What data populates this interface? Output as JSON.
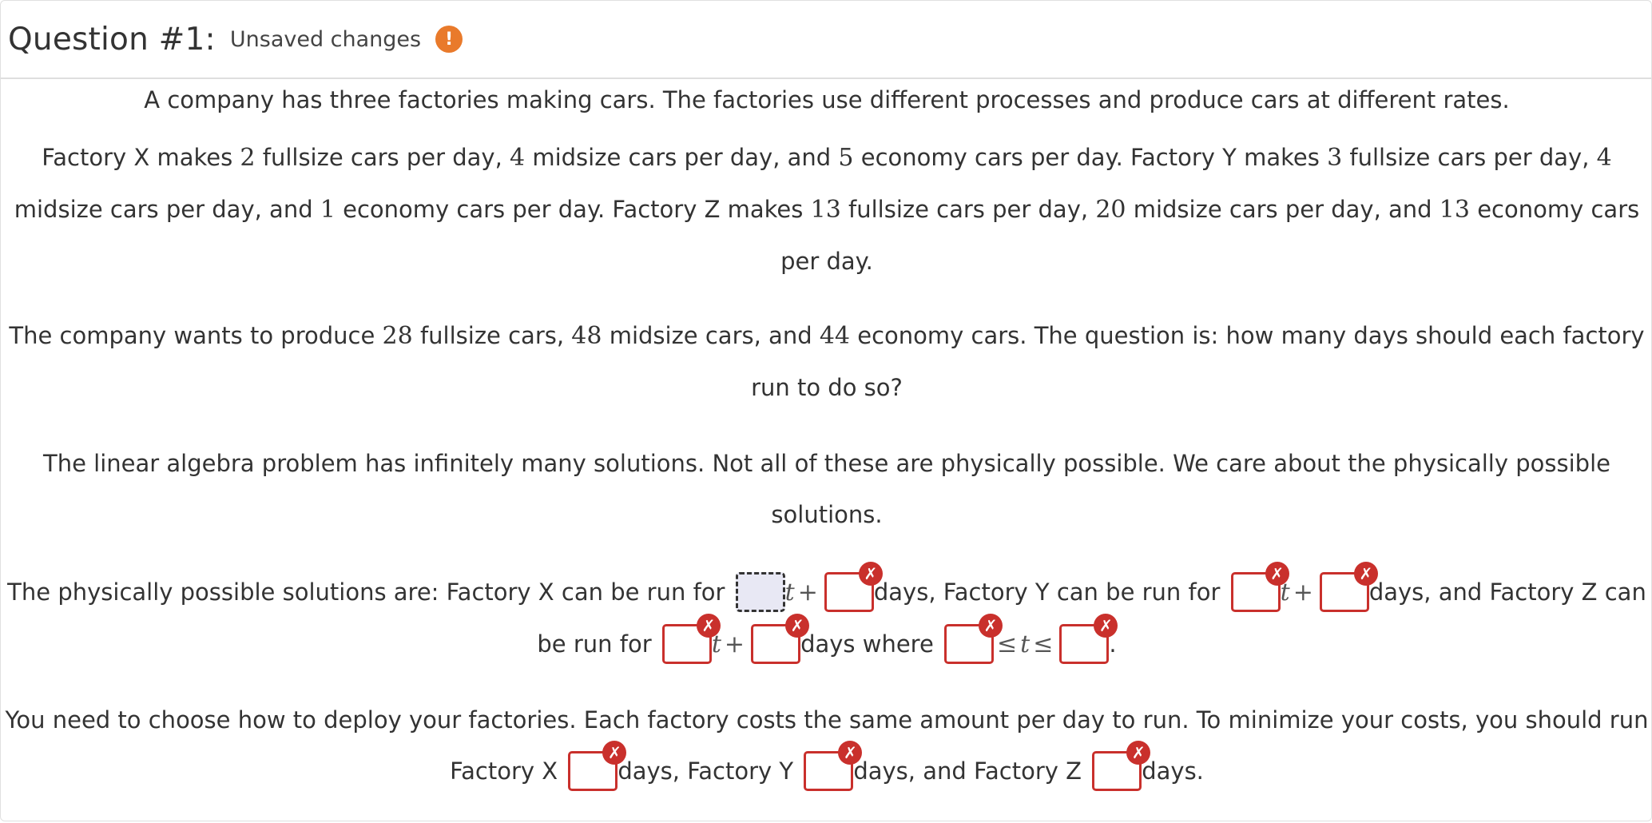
{
  "header": {
    "title": "Question #1:",
    "status": "Unsaved changes",
    "warning_glyph": "!"
  },
  "intro": "A company has three factories making cars. The factories use different processes and produce cars at different rates.",
  "rates": {
    "p1": "Factory X makes ",
    "x_full": "2",
    "p2": " fullsize cars per day, ",
    "x_mid": "4",
    "p3": " midsize cars per day, and ",
    "x_eco": "5",
    "p4": " economy cars per day. Factory Y makes ",
    "y_full": "3",
    "p5": " fullsize cars per day, ",
    "y_mid": "4",
    "p6": " midsize cars per day, and ",
    "y_eco": "1",
    "p7": " economy cars per day. Factory Z makes ",
    "z_full": "13",
    "p8": " fullsize cars per day, ",
    "z_mid": "20",
    "p9": " midsize cars per day, and ",
    "z_eco": "13",
    "p10": " economy cars per day."
  },
  "goal": {
    "p1": "The company wants to produce ",
    "full": "28",
    "p2": " fullsize cars, ",
    "mid": "48",
    "p3": " midsize cars, and ",
    "eco": "44",
    "p4": " economy cars. The question is: how many days should each factory run to do so?"
  },
  "note": "The linear algebra problem has infinitely many solutions. Not all of these are physically possible. We care about the physically possible solutions.",
  "solutions": {
    "p1": "The physically possible solutions are: Factory X can be run for ",
    "var": "t",
    "plus": "+",
    "p2": "days, Factory Y can be run for ",
    "p3": "days, and Factory Z can be run for ",
    "p4": "days where ",
    "leq": "≤",
    "end": "."
  },
  "deploy": {
    "p1": "You need to choose how to deploy your factories. Each factory costs the same amount per day to run. To minimize your costs, you should run Factory X ",
    "p2": "days, Factory Y ",
    "p3": "days, and Factory Z ",
    "p4": "days."
  },
  "invalid_glyph": "✗",
  "colors": {
    "warning": "#e97a2b",
    "invalid": "#c9302c",
    "focused_bg": "#e8e8f4"
  }
}
